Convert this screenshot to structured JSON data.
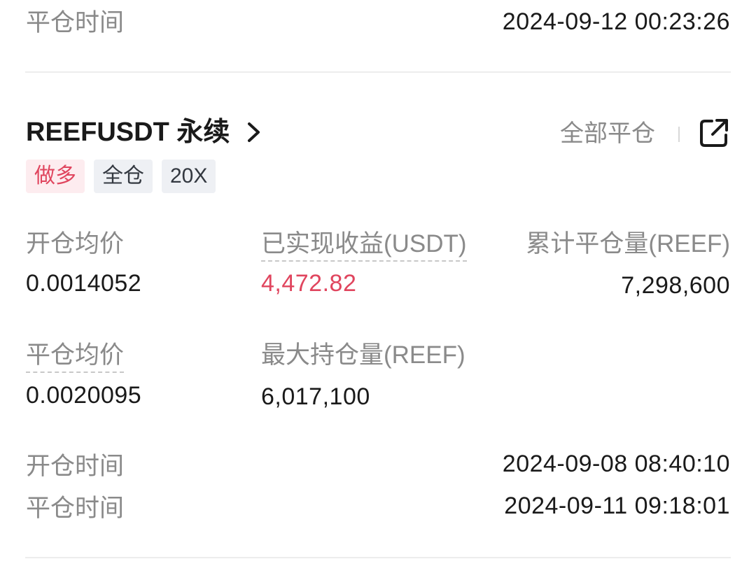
{
  "prev_record": {
    "close_time_label": "平仓时间",
    "close_time_value": "2024-09-12 00:23:26"
  },
  "record": {
    "symbol_title": "REEFUSDT 永续",
    "close_all_label": "全部平仓",
    "tags": {
      "side": "做多",
      "margin_mode": "全仓",
      "leverage": "20X"
    },
    "avg_open_price_label": "开仓均价",
    "avg_open_price_value": "0.0014052",
    "realized_pnl_label": "已实现收益(USDT)",
    "realized_pnl_value": "4,472.82",
    "total_closed_qty_label": "累计平仓量(REEF)",
    "total_closed_qty_value": "7,298,600",
    "avg_close_price_label": "平仓均价",
    "avg_close_price_value": "0.0020095",
    "max_position_label": "最大持仓量(REEF)",
    "max_position_value": "6,017,100",
    "open_time_label": "开仓时间",
    "open_time_value": "2024-09-08 08:40:10",
    "close_time_label": "平仓时间",
    "close_time_value": "2024-09-11 09:18:01"
  },
  "colors": {
    "profit": "#e0455e",
    "long_tag_bg": "#fdecef",
    "gray_tag_bg": "#eef0f4",
    "label": "#8a8a8a"
  },
  "icons": {
    "title_chevron": "chevron-right-icon",
    "share": "share-external-icon"
  }
}
